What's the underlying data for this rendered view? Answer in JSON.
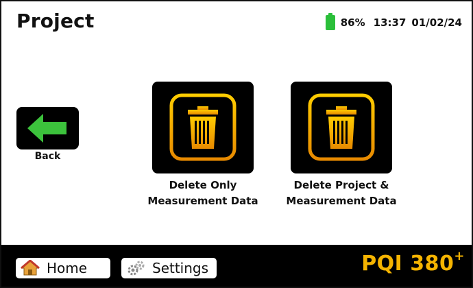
{
  "header": {
    "title": "Project",
    "battery_percent": "86%",
    "time": "13:37",
    "date": "01/02/24"
  },
  "back": {
    "label": "Back"
  },
  "actions": [
    {
      "line1": "Delete Only",
      "line2": "Measurement Data"
    },
    {
      "line1": "Delete Project &",
      "line2": "Measurement Data"
    }
  ],
  "footer": {
    "home_label": "Home",
    "settings_label": "Settings",
    "brand": "PQI 380",
    "brand_sup": "+"
  },
  "colors": {
    "accent": "#f5b400",
    "back_arrow": "#3cc23c",
    "battery": "#2bbf3a"
  },
  "icons": {
    "back": "arrow-left-icon",
    "delete": "trash-icon",
    "home": "house-icon",
    "settings": "gears-icon",
    "battery": "battery-icon"
  }
}
